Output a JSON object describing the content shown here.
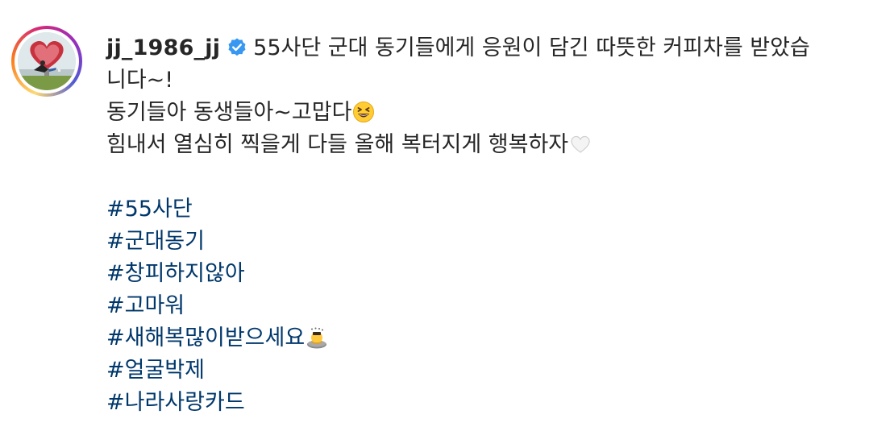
{
  "post": {
    "username": "jj_1986_jj",
    "verified_icon": "verified-badge-icon",
    "caption": {
      "line1": "55사단 군대 동기들에게 응원이 담긴 따뜻한 커피차를 받았습",
      "line2": "니다~!",
      "line3": "동기들아 동생들아~고맙다",
      "line3_emoji": "grinning-squinting-face-emoji",
      "line4": "힘내서 열심히 찍을게 다들 올해 복터지게 행복하자",
      "line4_emoji": "white-heart-emoji"
    },
    "hashtags": [
      "#55사단",
      "#군대동기",
      "#창피하지않아",
      "#고마워",
      "#새해복많이받으세요",
      "#얼굴박제",
      "#나라사랑카드"
    ],
    "hashtag_emoji": "person-bowing-emoji",
    "colors": {
      "text": "#262626",
      "hashtag": "#00376b",
      "verified": "#3897f0"
    }
  }
}
